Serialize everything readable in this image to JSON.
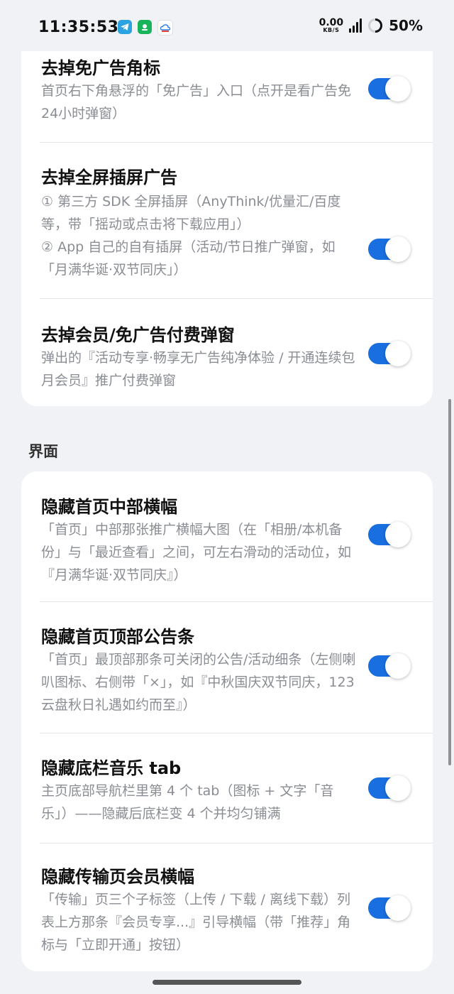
{
  "status_bar": {
    "time": "11:35:53",
    "net_speed": "0.00",
    "net_unit": "KB/S",
    "battery": "50%",
    "apps": [
      "telegram-icon",
      "green-app-icon",
      "cloud-app-icon"
    ]
  },
  "ad_section": {
    "rows": [
      {
        "title": "去掉免广告角标",
        "desc": [
          "首页右下角悬浮的「免广告」入口（点开是看广告免24小时弹窗）"
        ],
        "enabled": true
      },
      {
        "title": "去掉全屏插屏广告",
        "desc": [
          "① 第三方 SDK 全屏插屏（AnyThink/优量汇/百度 等，带「摇动或点击将下载应用」）",
          "② App 自己的自有插屏（活动/节日推广弹窗，如「月满华诞·双节同庆」）"
        ],
        "enabled": true
      },
      {
        "title": "去掉会员/免广告付费弹窗",
        "desc": [
          "弹出的『活动专享·畅享无广告纯净体验 / 开通连续包月会员』推广付费弹窗"
        ],
        "enabled": true
      }
    ]
  },
  "ui_section": {
    "label": "界面",
    "rows": [
      {
        "title": "隐藏首页中部横幅",
        "desc": [
          "「首页」中部那张推广横幅大图（在「相册/本机备份」与「最近查看」之间，可左右滑动的活动位，如『月满华诞·双节同庆』）"
        ],
        "enabled": true
      },
      {
        "title": "隐藏首页顶部公告条",
        "desc": [
          "「首页」最顶部那条可关闭的公告/活动细条（左侧喇叭图标、右侧带「×」，如『中秋国庆双节同庆，123云盘秋日礼遇如约而至』）"
        ],
        "enabled": true
      },
      {
        "title": "隐藏底栏音乐 tab",
        "desc": [
          "主页底部导航栏里第 4 个 tab（图标 + 文字「音乐」）——隐藏后底栏变 4 个并均匀铺满"
        ],
        "enabled": true
      },
      {
        "title": "隐藏传输页会员横幅",
        "desc": [
          "「传输」页三个子标签（上传 / 下载 / 离线下载）列表上方那条『会员专享...』引导横幅（带「推荐」角标与「立即开通」按钮）"
        ],
        "enabled": true
      }
    ]
  },
  "colors": {
    "accent": "#1a6fe0",
    "background": "#f1f2f5",
    "card": "#ffffff",
    "desc_text": "#8a8d93"
  }
}
